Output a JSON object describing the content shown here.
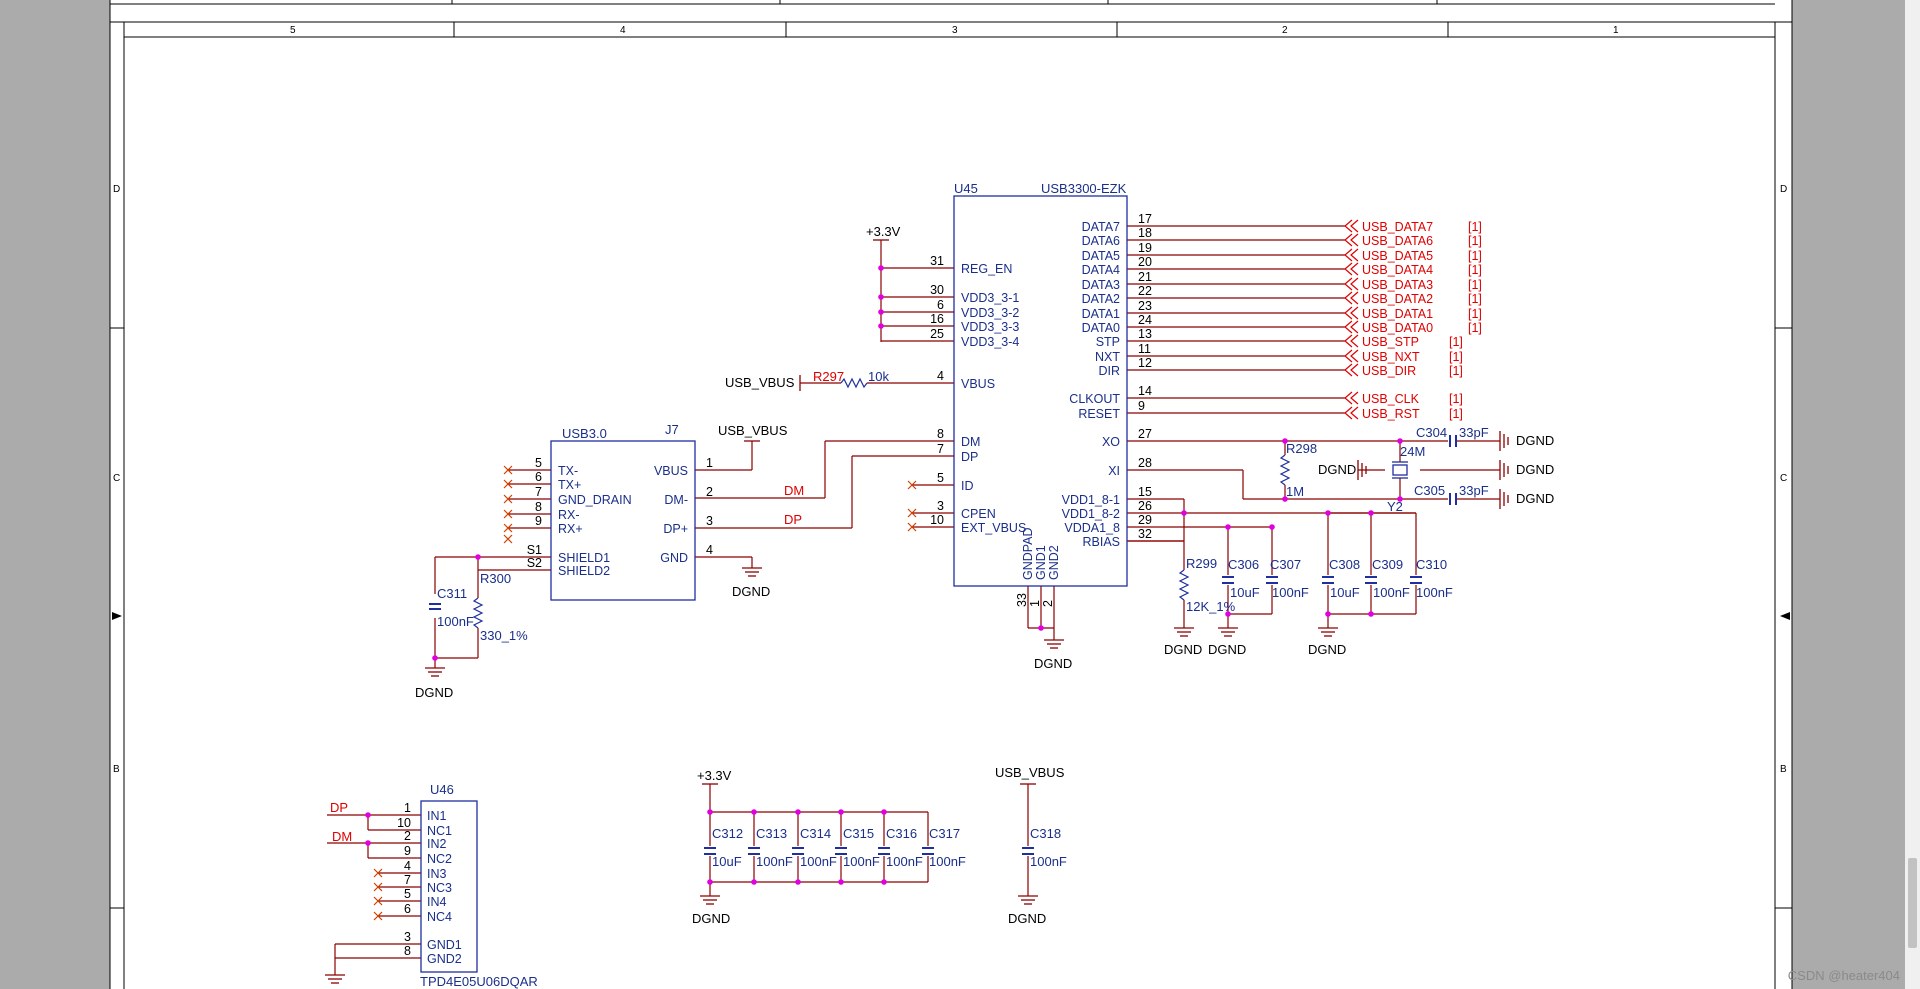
{
  "border": {
    "cols": [
      "5",
      "4",
      "3",
      "2",
      "1"
    ],
    "rows": [
      "D",
      "C",
      "B"
    ]
  },
  "watermark": "CSDN @heater404",
  "u45": {
    "ref": "U45",
    "part": "USB3300-EZK",
    "left_pins": [
      {
        "num": "31",
        "name": "REG_EN"
      },
      {
        "num": "30",
        "name": "VDD3_3-1"
      },
      {
        "num": "6",
        "name": "VDD3_3-2"
      },
      {
        "num": "16",
        "name": "VDD3_3-3"
      },
      {
        "num": "25",
        "name": "VDD3_3-4"
      },
      {
        "num": "4",
        "name": "VBUS"
      },
      {
        "num": "8",
        "name": "DM"
      },
      {
        "num": "7",
        "name": "DP"
      },
      {
        "num": "5",
        "name": "ID"
      },
      {
        "num": "3",
        "name": "CPEN"
      },
      {
        "num": "10",
        "name": "EXT_VBUS"
      }
    ],
    "right_pins": [
      {
        "num": "17",
        "name": "DATA7",
        "net": "USB_DATA7",
        "ref": "[1]"
      },
      {
        "num": "18",
        "name": "DATA6",
        "net": "USB_DATA6",
        "ref": "[1]"
      },
      {
        "num": "19",
        "name": "DATA5",
        "net": "USB_DATA5",
        "ref": "[1]"
      },
      {
        "num": "20",
        "name": "DATA4",
        "net": "USB_DATA4",
        "ref": "[1]"
      },
      {
        "num": "21",
        "name": "DATA3",
        "net": "USB_DATA3",
        "ref": "[1]"
      },
      {
        "num": "22",
        "name": "DATA2",
        "net": "USB_DATA2",
        "ref": "[1]"
      },
      {
        "num": "23",
        "name": "DATA1",
        "net": "USB_DATA1",
        "ref": "[1]"
      },
      {
        "num": "24",
        "name": "DATA0",
        "net": "USB_DATA0",
        "ref": "[1]"
      },
      {
        "num": "13",
        "name": "STP",
        "net": "USB_STP",
        "ref": "[1]"
      },
      {
        "num": "11",
        "name": "NXT",
        "net": "USB_NXT",
        "ref": "[1]"
      },
      {
        "num": "12",
        "name": "DIR",
        "net": "USB_DIR",
        "ref": "[1]"
      },
      {
        "num": "14",
        "name": "CLKOUT",
        "net": "USB_CLK",
        "ref": "[1]"
      },
      {
        "num": "9",
        "name": "RESET",
        "net": "USB_RST",
        "ref": "[1]"
      },
      {
        "num": "27",
        "name": "XO",
        "net": "",
        "ref": ""
      },
      {
        "num": "28",
        "name": "XI",
        "net": "",
        "ref": ""
      },
      {
        "num": "15",
        "name": "VDD1_8-1",
        "net": "",
        "ref": ""
      },
      {
        "num": "26",
        "name": "VDD1_8-2",
        "net": "",
        "ref": ""
      },
      {
        "num": "29",
        "name": "VDDA1_8",
        "net": "",
        "ref": ""
      },
      {
        "num": "32",
        "name": "RBIAS",
        "net": "",
        "ref": ""
      }
    ],
    "bottom_pins": [
      {
        "num": "33",
        "name": "GNDPAD"
      },
      {
        "num": "1",
        "name": "GND1"
      },
      {
        "num": "2",
        "name": "GND2"
      }
    ]
  },
  "j7": {
    "type": "USB3.0",
    "ref": "J7",
    "left_pins": [
      {
        "num": "5",
        "name": "TX-"
      },
      {
        "num": "6",
        "name": "TX+"
      },
      {
        "num": "7",
        "name": "GND_DRAIN"
      },
      {
        "num": "8",
        "name": "RX-"
      },
      {
        "num": "9",
        "name": "RX+"
      },
      {
        "num": "S1",
        "name": "SHIELD1"
      },
      {
        "num": "S2",
        "name": "SHIELD2"
      }
    ],
    "right_pins": [
      {
        "num": "1",
        "name": "VBUS"
      },
      {
        "num": "2",
        "name": "DM-"
      },
      {
        "num": "3",
        "name": "DP+"
      },
      {
        "num": "4",
        "name": "GND"
      }
    ]
  },
  "u46": {
    "ref": "U46",
    "part": "TPD4E05U06DQAR",
    "pins": [
      {
        "num": "1",
        "name": "IN1"
      },
      {
        "num": "10",
        "name": "NC1"
      },
      {
        "num": "2",
        "name": "IN2"
      },
      {
        "num": "9",
        "name": "NC2"
      },
      {
        "num": "4",
        "name": "IN3"
      },
      {
        "num": "7",
        "name": "NC3"
      },
      {
        "num": "5",
        "name": "IN4"
      },
      {
        "num": "6",
        "name": "NC4"
      },
      {
        "num": "3",
        "name": "GND1"
      },
      {
        "num": "8",
        "name": "GND2"
      }
    ]
  },
  "nets": {
    "v33": "+3.3V",
    "usb_vbus": "USB_VBUS",
    "dgnd": "DGND",
    "dm": "DM",
    "dp": "DP"
  },
  "components": {
    "r297": {
      "ref": "R297",
      "value": "10k"
    },
    "r298": {
      "ref": "R298",
      "value": "1M"
    },
    "r299": {
      "ref": "R299",
      "value": "12K_1%"
    },
    "r300": {
      "ref": "R300",
      "value": "330_1%"
    },
    "y2": {
      "ref": "Y2",
      "value": "24M"
    },
    "c304": {
      "ref": "C304",
      "value": "33pF"
    },
    "c305": {
      "ref": "C305",
      "value": "33pF"
    },
    "c306": {
      "ref": "C306",
      "value": "10uF"
    },
    "c307": {
      "ref": "C307",
      "value": "100nF"
    },
    "c308": {
      "ref": "C308",
      "value": "10uF"
    },
    "c309": {
      "ref": "C309",
      "value": "100nF"
    },
    "c310": {
      "ref": "C310",
      "value": "100nF"
    },
    "c311": {
      "ref": "C311",
      "value": "100nF"
    },
    "c312": {
      "ref": "C312",
      "value": "10uF"
    },
    "c313": {
      "ref": "C313",
      "value": "100nF"
    },
    "c314": {
      "ref": "C314",
      "value": "100nF"
    },
    "c315": {
      "ref": "C315",
      "value": "100nF"
    },
    "c316": {
      "ref": "C316",
      "value": "100nF"
    },
    "c317": {
      "ref": "C317",
      "value": "100nF"
    },
    "c318": {
      "ref": "C318",
      "value": "100nF"
    }
  }
}
